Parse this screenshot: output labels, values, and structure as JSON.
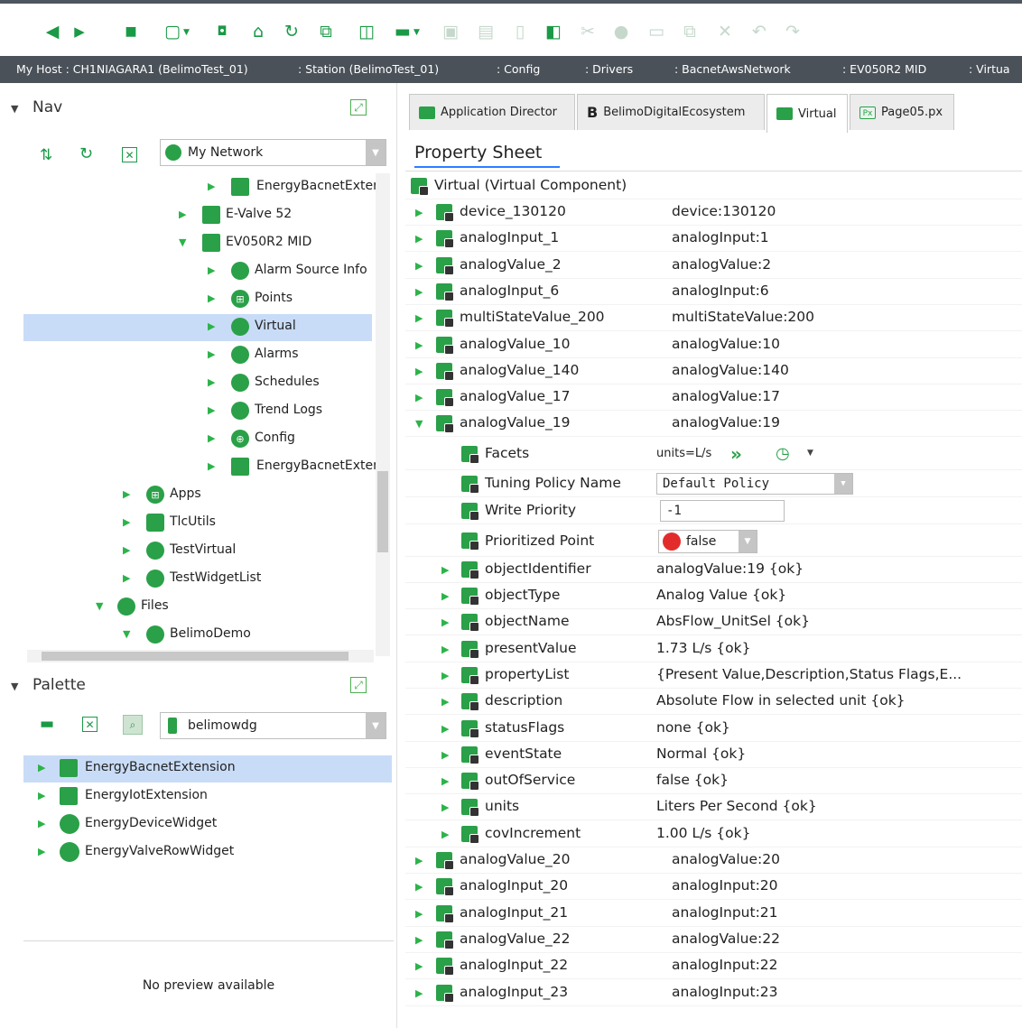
{
  "breadcrumb": [
    "My Host : CH1NIAGARA1 (BelimoTest_01)",
    ": Station (BelimoTest_01)",
    ": Config",
    ": Drivers",
    ": BacnetAwsNetwork",
    ": EV050R2 MID",
    ": Virtua"
  ],
  "nav": {
    "title": "Nav",
    "combo": "My Network",
    "items": [
      {
        "label": "EnergyBacnetExten",
        "expanded": false
      },
      {
        "label": "E-Valve 52",
        "expanded": false
      },
      {
        "label": "EV050R2 MID",
        "expanded": true
      },
      {
        "label": "Alarm Source Info",
        "expanded": false
      },
      {
        "label": "Points",
        "expanded": false
      },
      {
        "label": "Virtual",
        "expanded": false,
        "selected": true
      },
      {
        "label": "Alarms",
        "expanded": false
      },
      {
        "label": "Schedules",
        "expanded": false
      },
      {
        "label": "Trend Logs",
        "expanded": false
      },
      {
        "label": "Config",
        "expanded": false
      },
      {
        "label": "EnergyBacnetExten",
        "expanded": false
      },
      {
        "label": "Apps",
        "expanded": false
      },
      {
        "label": "TlcUtils",
        "expanded": false
      },
      {
        "label": "TestVirtual",
        "expanded": false
      },
      {
        "label": "TestWidgetList",
        "expanded": false
      },
      {
        "label": "Files",
        "expanded": true
      },
      {
        "label": "BelimoDemo",
        "expanded": true
      }
    ]
  },
  "palette": {
    "title": "Palette",
    "combo": "belimowdg",
    "items": [
      {
        "label": "EnergyBacnetExtension",
        "selected": true
      },
      {
        "label": "EnergyIotExtension"
      },
      {
        "label": "EnergyDeviceWidget"
      },
      {
        "label": "EnergyValveRowWidget"
      }
    ],
    "preview": "No preview available"
  },
  "tabs": [
    {
      "label": "Application Director",
      "active": false
    },
    {
      "label": "BelimoDigitalEcosystem",
      "active": false
    },
    {
      "label": "Virtual",
      "active": true
    },
    {
      "label": "Page05.px",
      "active": false
    }
  ],
  "property_sheet": {
    "title": "Property Sheet",
    "root": "Virtual  (Virtual Component)",
    "rows_top": [
      {
        "name": "device_130120",
        "value": "device:130120"
      },
      {
        "name": "analogInput_1",
        "value": "analogInput:1"
      },
      {
        "name": "analogValue_2",
        "value": "analogValue:2"
      },
      {
        "name": "analogInput_6",
        "value": "analogInput:6"
      },
      {
        "name": "multiStateValue_200",
        "value": "multiStateValue:200"
      },
      {
        "name": "analogValue_10",
        "value": "analogValue:10"
      },
      {
        "name": "analogValue_140",
        "value": "analogValue:140"
      },
      {
        "name": "analogValue_17",
        "value": "analogValue:17"
      },
      {
        "name": "analogValue_19",
        "value": "analogValue:19"
      }
    ],
    "facets": {
      "name": "Facets",
      "value": "units=L/s"
    },
    "tuning_policy": {
      "name": "Tuning Policy Name",
      "value": "Default Policy"
    },
    "write_priority": {
      "name": "Write Priority",
      "value": "-1"
    },
    "prioritized_point": {
      "name": "Prioritized Point",
      "value": "false"
    },
    "rows_child": [
      {
        "name": "objectIdentifier",
        "value": "analogValue:19 {ok}"
      },
      {
        "name": "objectType",
        "value": "Analog Value {ok}"
      },
      {
        "name": "objectName",
        "value": "AbsFlow_UnitSel {ok}"
      },
      {
        "name": "presentValue",
        "value": "1.73 L/s {ok}"
      },
      {
        "name": "propertyList",
        "value": "{Present Value,Description,Status Flags,E..."
      },
      {
        "name": "description",
        "value": "Absolute Flow in selected unit {ok}"
      },
      {
        "name": "statusFlags",
        "value": "none {ok}"
      },
      {
        "name": "eventState",
        "value": "Normal {ok}"
      },
      {
        "name": "outOfService",
        "value": "false {ok}"
      },
      {
        "name": "units",
        "value": "Liters Per Second {ok}"
      },
      {
        "name": "covIncrement",
        "value": "1.00 L/s {ok}"
      }
    ],
    "rows_bottom": [
      {
        "name": "analogValue_20",
        "value": "analogValue:20"
      },
      {
        "name": "analogInput_20",
        "value": "analogInput:20"
      },
      {
        "name": "analogInput_21",
        "value": "analogInput:21"
      },
      {
        "name": "analogValue_22",
        "value": "analogValue:22"
      },
      {
        "name": "analogInput_22",
        "value": "analogInput:22"
      },
      {
        "name": "analogInput_23",
        "value": "analogInput:23"
      }
    ]
  },
  "colors": {
    "accent_green": "#2aa048",
    "header_bar": "#4a5159",
    "selection": "#c9dcf7"
  }
}
